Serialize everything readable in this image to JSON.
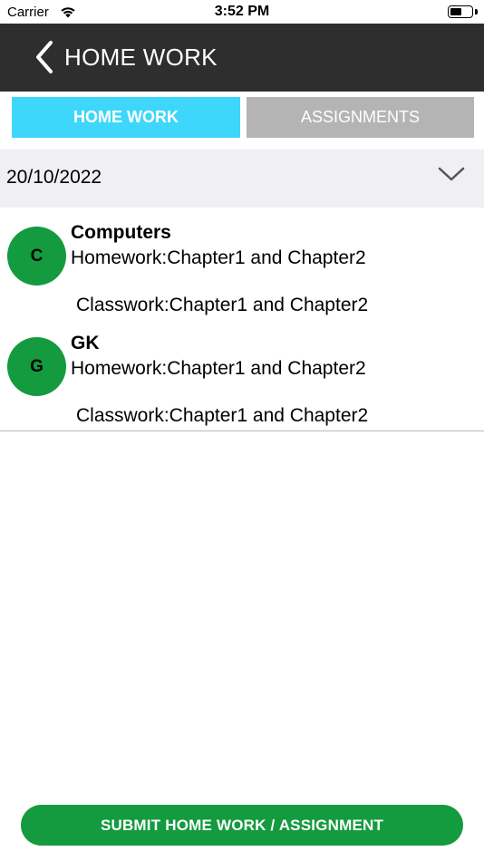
{
  "status_bar": {
    "carrier": "Carrier",
    "time": "3:52 PM",
    "battery_level": 0.55
  },
  "nav": {
    "title": "HOME WORK",
    "back_icon": "chevron-left-icon"
  },
  "tabs": [
    {
      "label": "HOME WORK",
      "active": true,
      "color": "#3ed6fb"
    },
    {
      "label": "ASSIGNMENTS",
      "active": false,
      "color": "#b4b4b4"
    }
  ],
  "date_selector": {
    "value": "20/10/2022",
    "icon": "chevron-down-icon"
  },
  "homework_items": [
    {
      "initial": "C",
      "subject": "Computers",
      "homework": "Homework:Chapter1 and Chapter2",
      "classwork": "Classwork:Chapter1 and Chapter2"
    },
    {
      "initial": "G",
      "subject": "GK",
      "homework": "Homework:Chapter1 and Chapter2",
      "classwork": "Classwork:Chapter1 and Chapter2"
    }
  ],
  "submit_button": {
    "label": "SUBMIT HOME WORK / ASSIGNMENT"
  },
  "colors": {
    "nav_background": "#2e2e2e",
    "accent_green": "#149b3f",
    "tab_active": "#3ed6fb",
    "tab_inactive": "#b4b4b4",
    "date_row_background": "#efeff4"
  }
}
